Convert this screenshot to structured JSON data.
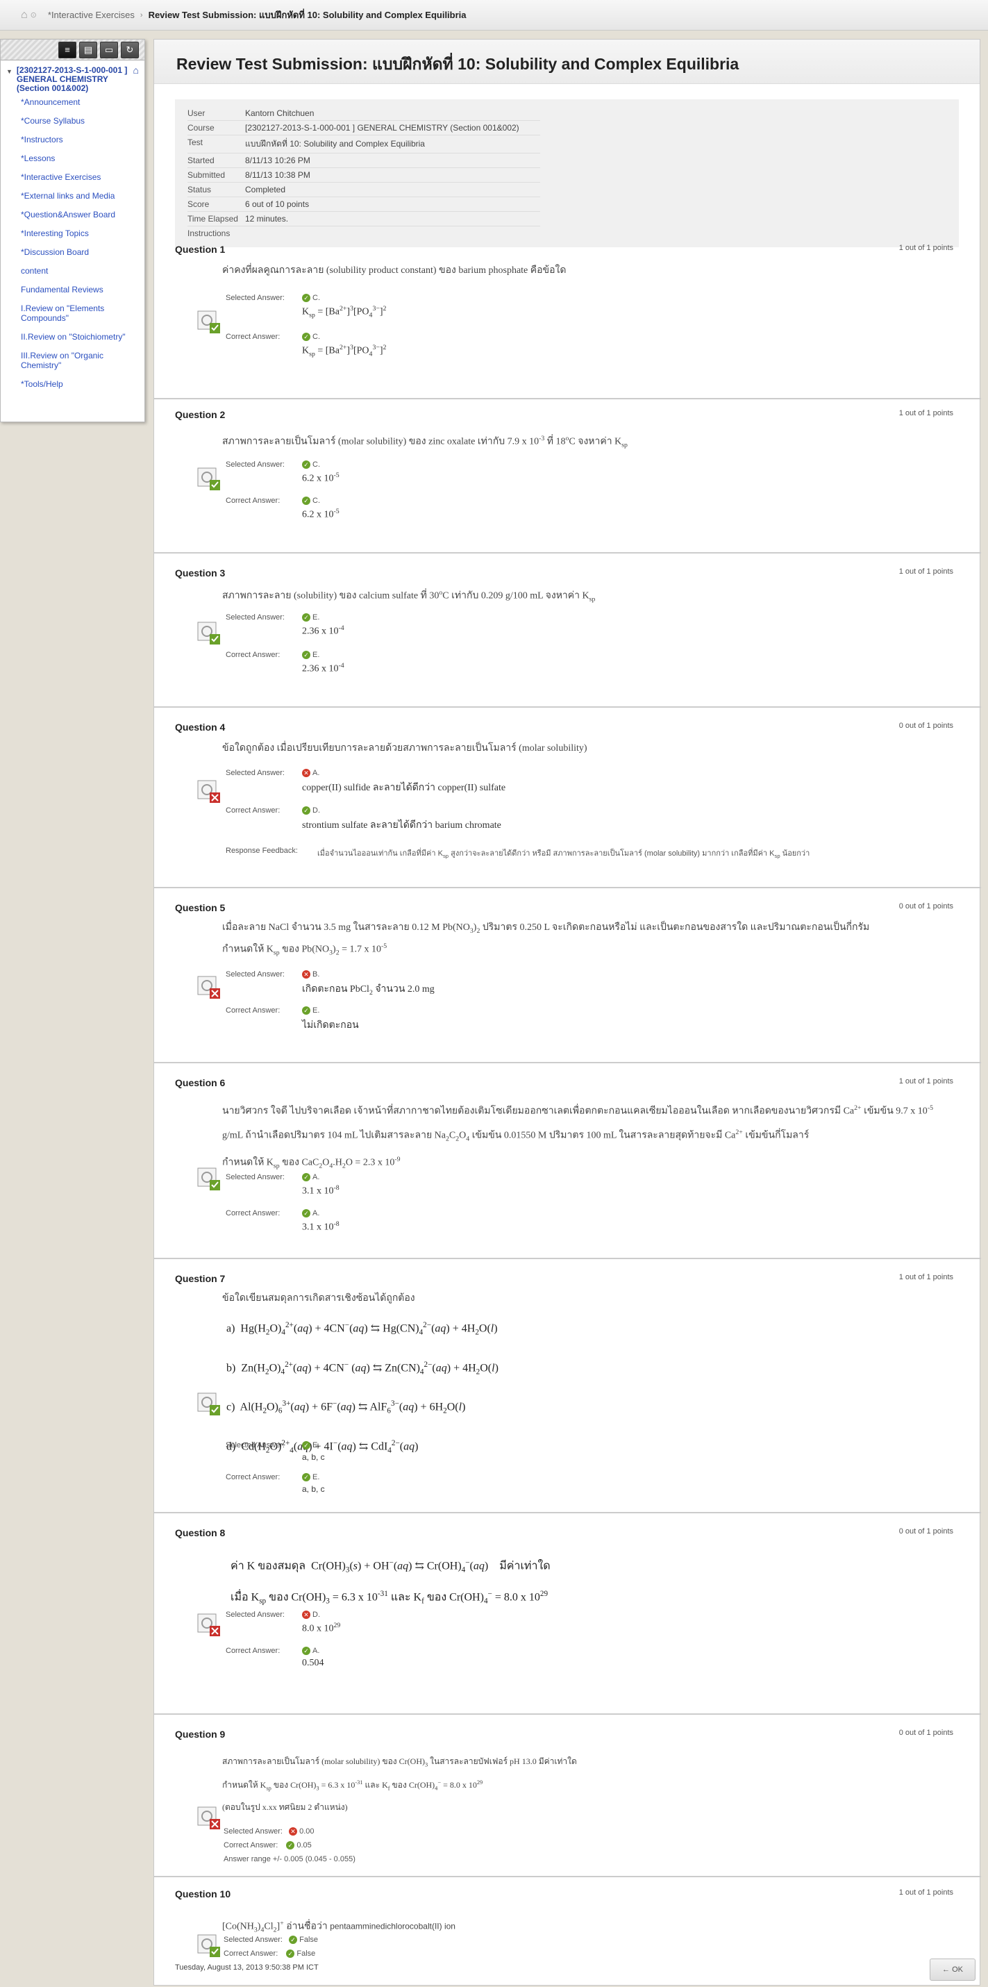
{
  "breadcrumb": {
    "parent": "*Interactive Exercises",
    "current": "Review Test Submission: แบบฝึกหัดที่ 10: Solubility and Complex Equilibria"
  },
  "sidebar": {
    "course_title": "[2302127-2013-S-1-000-001 ] GENERAL CHEMISTRY (Section 001&002)",
    "items": [
      "*Announcement",
      "*Course Syllabus",
      "*Instructors",
      "*Lessons",
      "*Interactive Exercises",
      "*External links and Media",
      "*Question&Answer Board",
      "*Interesting Topics",
      "*Discussion Board",
      "content",
      "Fundamental Reviews",
      "I.Review on \"Elements Compounds\"",
      "II.Review on \"Stoichiometry\"",
      "III.Review on \"Organic Chemistry\"",
      "*Tools/Help"
    ]
  },
  "page_title": "Review Test Submission: แบบฝึกหัดที่ 10: Solubility and Complex Equilibria",
  "info": [
    {
      "k": "User",
      "v": "Kantorn Chitchuen"
    },
    {
      "k": "Course",
      "v": "[2302127-2013-S-1-000-001 ] GENERAL CHEMISTRY (Section 001&002)"
    },
    {
      "k": "Test",
      "v": "แบบฝึกหัดที่ 10: Solubility and Complex Equilibria"
    },
    {
      "k": "Started",
      "v": "8/11/13 10:26 PM"
    },
    {
      "k": "Submitted",
      "v": "8/11/13 10:38 PM"
    },
    {
      "k": "Status",
      "v": "Completed"
    },
    {
      "k": "Score",
      "v": "6 out of 10 points"
    },
    {
      "k": "Time Elapsed",
      "v": "12 minutes."
    },
    {
      "k": "Instructions",
      "v": ""
    }
  ],
  "labels": {
    "selected": "Selected Answer:",
    "correct": "Correct Answer:",
    "feedback": "Response Feedback:",
    "range": "Answer range +/- 0.005 (0.045 - 0.055)"
  },
  "questions": [
    {
      "title": "Question 1",
      "points": "1 out of 1 points",
      "correct": true,
      "sel_letter": "C.",
      "cor_letter": "C."
    },
    {
      "title": "Question 2",
      "points": "1 out of 1 points",
      "correct": true,
      "sel_letter": "C.",
      "cor_letter": "C."
    },
    {
      "title": "Question 3",
      "points": "1 out of 1 points",
      "correct": true,
      "sel_letter": "E.",
      "cor_letter": "E."
    },
    {
      "title": "Question 4",
      "points": "0 out of 1 points",
      "correct": false,
      "sel_letter": "A.",
      "cor_letter": "D.",
      "sel_text": "copper(II) sulfide ละลายได้ดีกว่า copper(II) sulfate",
      "cor_text": "strontium sulfate ละลายได้ดีกว่า barium chromate"
    },
    {
      "title": "Question 5",
      "points": "0 out of 1 points",
      "correct": false,
      "sel_letter": "B.",
      "cor_letter": "E.",
      "cor_text": "ไม่เกิดตะกอน"
    },
    {
      "title": "Question 6",
      "points": "1 out of 1 points",
      "correct": true,
      "sel_letter": "A.",
      "cor_letter": "A."
    },
    {
      "title": "Question 7",
      "points": "1 out of 1 points",
      "correct": true,
      "q_text": "ข้อใดเขียนสมดุลการเกิดสารเชิงซ้อนได้ถูกต้อง",
      "sel_letter": "E.",
      "cor_letter": "E.",
      "sel_text": "a, b, c",
      "cor_text": "a, b, c"
    },
    {
      "title": "Question 8",
      "points": "0 out of 1 points",
      "correct": false,
      "sel_letter": "D.",
      "cor_letter": "A.",
      "cor_text": "0.504"
    },
    {
      "title": "Question 9",
      "points": "0 out of 1 points",
      "correct": false,
      "q_tail": "(ตอบในรูป x.xx ทศนิยม 2 ตำแหน่ง)",
      "sel_value": "0.00",
      "cor_value": "0.05"
    },
    {
      "title": "Question 10",
      "points": "1 out of 1 points",
      "correct": true,
      "sel_value": "False",
      "cor_value": "False"
    }
  ],
  "timestamp": "Tuesday, August 13, 2013 9:50:38 PM ICT",
  "ok_label": "OK"
}
